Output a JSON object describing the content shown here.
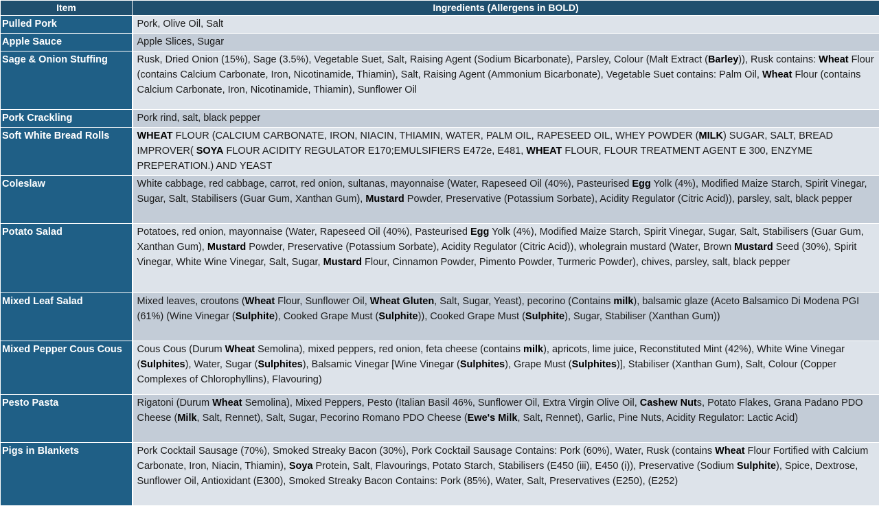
{
  "headers": {
    "item": "Item",
    "ingredients": "Ingredients (Allergens in BOLD)"
  },
  "rows": [
    {
      "item": "Pulled Pork",
      "ingredients": [
        {
          "t": "Pork, Olive Oil, Salt"
        }
      ]
    },
    {
      "item": "Apple Sauce",
      "ingredients": [
        {
          "t": "Apple Slices, Sugar"
        }
      ]
    },
    {
      "item": "Sage & Onion Stuffing",
      "ingredients": [
        {
          "t": "Rusk, Dried Onion (15%), Sage (3.5%), Vegetable Suet, Salt, Raising Agent (Sodium Bicarbonate), Parsley, Colour (Malt Extract ("
        },
        {
          "t": "Barley",
          "b": true
        },
        {
          "t": ")), Rusk contains: "
        },
        {
          "t": "Wheat",
          "b": true
        },
        {
          "t": " Flour (contains Calcium Carbonate, Iron, Nicotinamide, Thiamin), Salt, Raising Agent (Ammonium Bicarbonate), Vegetable Suet contains: Palm Oil, "
        },
        {
          "t": "Wheat",
          "b": true
        },
        {
          "t": " Flour (contains Calcium Carbonate, Iron, Nicotinamide, Thiamin), Sunflower Oil"
        }
      ]
    },
    {
      "item": "Pork Crackling",
      "ingredients": [
        {
          "t": "Pork rind, salt, black pepper"
        }
      ]
    },
    {
      "item": "Soft White Bread Rolls",
      "ingredients": [
        {
          "t": "WHEAT",
          "b": true
        },
        {
          "t": " FLOUR (CALCIUM CARBONATE, IRON, NIACIN, THIAMIN, WATER, PALM OIL, RAPESEED OIL, WHEY POWDER ("
        },
        {
          "t": "MILK",
          "b": true
        },
        {
          "t": ") SUGAR, SALT, BREAD IMPROVER( "
        },
        {
          "t": "SOYA",
          "b": true
        },
        {
          "t": " FLOUR ACIDITY REGULATOR E170;EMULSIFIERS E472e, E481, "
        },
        {
          "t": "WHEAT",
          "b": true
        },
        {
          "t": " FLOUR, FLOUR TREATMENT AGENT E 300, ENZYME PREPERATION.) AND YEAST"
        }
      ]
    },
    {
      "item": "Coleslaw",
      "ingredients": [
        {
          "t": "White cabbage, red cabbage, carrot, red onion, sultanas, mayonnaise (Water, Rapeseed Oil (40%), Pasteurised "
        },
        {
          "t": "Egg",
          "b": true
        },
        {
          "t": " Yolk (4%), Modified Maize Starch, Spirit Vinegar, Sugar, Salt, Stabilisers (Guar Gum, Xanthan Gum), "
        },
        {
          "t": "Mustard",
          "b": true
        },
        {
          "t": " Powder, Preservative (Potassium Sorbate), Acidity Regulator (Citric Acid)), parsley, salt, black pepper"
        }
      ]
    },
    {
      "item": "Potato Salad",
      "ingredients": [
        {
          "t": "Potatoes, red onion, mayonnaise (Water, Rapeseed Oil (40%), Pasteurised "
        },
        {
          "t": "Egg",
          "b": true
        },
        {
          "t": " Yolk (4%), Modified Maize Starch, Spirit Vinegar, Sugar, Salt, Stabilisers (Guar Gum, Xanthan Gum), "
        },
        {
          "t": "Mustard",
          "b": true
        },
        {
          "t": " Powder, Preservative (Potassium Sorbate), Acidity Regulator (Citric Acid)), wholegrain mustard (Water, Brown "
        },
        {
          "t": "Mustard",
          "b": true
        },
        {
          "t": " Seed (30%), Spirit Vinegar, White Wine Vinegar, Salt, Sugar, "
        },
        {
          "t": "Mustard",
          "b": true
        },
        {
          "t": " Flour, Cinnamon Powder, Pimento Powder, Turmeric Powder), chives, parsley, salt, black pepper"
        }
      ]
    },
    {
      "item": "Mixed Leaf Salad",
      "ingredients": [
        {
          "t": "Mixed leaves, croutons ("
        },
        {
          "t": "Wheat",
          "b": true
        },
        {
          "t": " Flour, Sunflower Oil, "
        },
        {
          "t": "Wheat Gluten",
          "b": true
        },
        {
          "t": ", Salt, Sugar, Yeast), pecorino (Contains "
        },
        {
          "t": "milk",
          "b": true
        },
        {
          "t": "), balsamic glaze (Aceto Balsamico Di Modena PGI (61%) (Wine Vinegar ("
        },
        {
          "t": "Sulphite",
          "b": true
        },
        {
          "t": "), Cooked Grape Must ("
        },
        {
          "t": "Sulphite",
          "b": true
        },
        {
          "t": ")), Cooked Grape Must ("
        },
        {
          "t": "Sulphite",
          "b": true
        },
        {
          "t": "), Sugar, Stabiliser (Xanthan Gum))"
        }
      ]
    },
    {
      "item": "Mixed Pepper Cous Cous",
      "ingredients": [
        {
          "t": "Cous Cous (Durum "
        },
        {
          "t": "Wheat",
          "b": true
        },
        {
          "t": " Semolina), mixed peppers, red onion, feta cheese (contains "
        },
        {
          "t": "milk",
          "b": true
        },
        {
          "t": "), apricots, lime juice, Reconstituted Mint (42%), White Wine Vinegar ("
        },
        {
          "t": "Sulphites",
          "b": true
        },
        {
          "t": "), Water, Sugar ("
        },
        {
          "t": "Sulphites",
          "b": true
        },
        {
          "t": "), Balsamic Vinegar [Wine Vinegar ("
        },
        {
          "t": "Sulphites",
          "b": true
        },
        {
          "t": "), Grape Must ("
        },
        {
          "t": "Sulphites",
          "b": true
        },
        {
          "t": ")], Stabiliser (Xanthan Gum), Salt, Colour (Copper Complexes of Chlorophyllins), Flavouring)"
        }
      ]
    },
    {
      "item": "Pesto Pasta",
      "ingredients": [
        {
          "t": "Rigatoni (Durum "
        },
        {
          "t": "Wheat",
          "b": true
        },
        {
          "t": " Semolina), Mixed Peppers, Pesto (Italian Basil 46%, Sunflower Oil, Extra Virgin Olive Oil, "
        },
        {
          "t": "Cashew Nut",
          "b": true
        },
        {
          "t": "s, Potato Flakes, Grana Padano PDO Cheese ("
        },
        {
          "t": "Milk",
          "b": true
        },
        {
          "t": ", Salt, Rennet), Salt, Sugar, Pecorino Romano PDO Cheese ("
        },
        {
          "t": "Ewe's Milk",
          "b": true
        },
        {
          "t": ", Salt, Rennet), Garlic, Pine Nuts, Acidity Regulator: Lactic Acid)"
        }
      ]
    },
    {
      "item": "Pigs in Blankets",
      "ingredients": [
        {
          "t": "Pork Cocktail Sausage (70%), Smoked Streaky Bacon (30%), Pork Cocktail Sausage Contains: Pork (60%), Water, Rusk (contains "
        },
        {
          "t": "Wheat",
          "b": true
        },
        {
          "t": " Flour Fortified with Calcium Carbonate, Iron, Niacin, Thiamin), "
        },
        {
          "t": "Soya",
          "b": true
        },
        {
          "t": " Protein, Salt, Flavourings, Potato Starch, Stabilisers (E450 (iii), E450 (i)), Preservative (Sodium "
        },
        {
          "t": "Sulphite",
          "b": true
        },
        {
          "t": "), Spice, Dextrose, Sunflower Oil, Antioxidant (E300), Smoked Streaky Bacon Contains: Pork (85%), Water, Salt, Preservatives (E250), (E252)"
        }
      ]
    }
  ]
}
